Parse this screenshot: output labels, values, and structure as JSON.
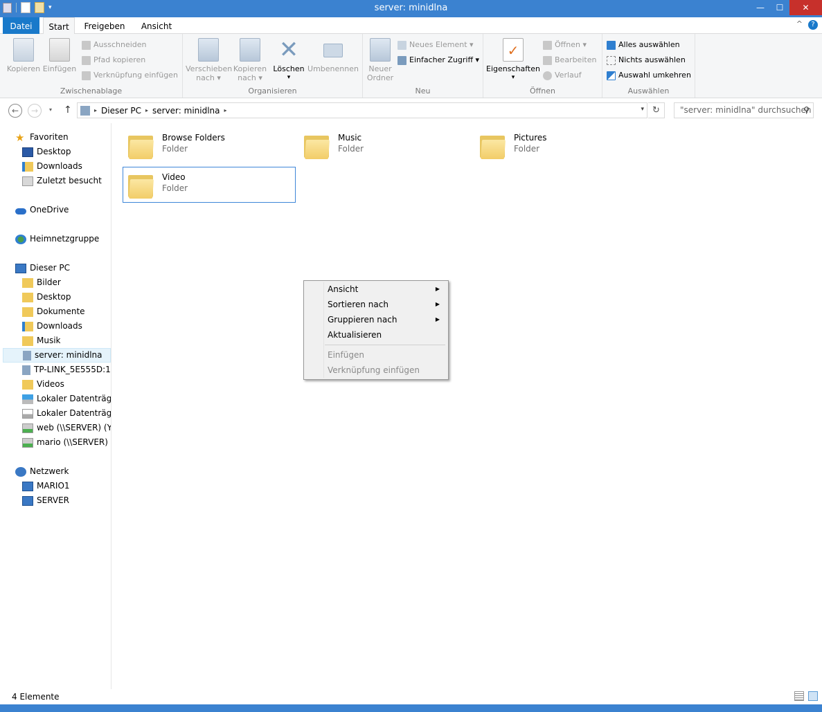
{
  "window": {
    "title": "server: minidlna",
    "controls": {
      "minimize": "—",
      "maximize": "☐",
      "close": "✕"
    }
  },
  "tabs": {
    "file": "Datei",
    "start": "Start",
    "share": "Freigeben",
    "view": "Ansicht",
    "help": "?",
    "collapse": "^"
  },
  "ribbon": {
    "clipboard": {
      "label": "Zwischenablage",
      "copy": "Kopieren",
      "paste": "Einfügen",
      "cut": "Ausschneiden",
      "copy_path": "Pfad kopieren",
      "paste_link": "Verknüpfung einfügen"
    },
    "organize": {
      "label": "Organisieren",
      "move_to": [
        "Verschieben",
        "nach ▾"
      ],
      "copy_to": [
        "Kopieren",
        "nach ▾"
      ],
      "delete": "Löschen",
      "delete_arrow": "▾",
      "rename": "Umbenennen"
    },
    "new": {
      "label": "Neu",
      "new_folder": [
        "Neuer",
        "Ordner"
      ],
      "new_item": "Neues Element ▾",
      "easy_access": "Einfacher Zugriff ▾"
    },
    "open": {
      "label": "Öffnen",
      "properties": "Eigenschaften",
      "properties_arrow": "▾",
      "open": "Öffnen ▾",
      "edit": "Bearbeiten",
      "history": "Verlauf"
    },
    "select": {
      "label": "Auswählen",
      "select_all": "Alles auswählen",
      "select_none": "Nichts auswählen",
      "invert": "Auswahl umkehren"
    }
  },
  "address": {
    "back": "←",
    "forward": "→",
    "recent": "▾",
    "up": "↑",
    "crumbs": [
      "Dieser PC",
      "server: minidlna"
    ],
    "separator": "▸",
    "dropdown": "▾",
    "refresh": "↻",
    "search_placeholder": "\"server: minidlna\" durchsuchen",
    "search_icon": "⚲"
  },
  "nav": {
    "favorites": "Favoriten",
    "fav_items": [
      "Desktop",
      "Downloads",
      "Zuletzt besucht"
    ],
    "onedrive": "OneDrive",
    "homegroup": "Heimnetzgruppe",
    "thispc": "Dieser PC",
    "pc_items": [
      "Bilder",
      "Desktop",
      "Dokumente",
      "Downloads",
      "Musik",
      "server: minidlna",
      "TP-LINK_5E555D:1",
      "Videos",
      "Lokaler Datenträger",
      "Lokaler Datenträger",
      "web (\\\\SERVER) (Y:)",
      "mario (\\\\SERVER) (Z"
    ],
    "network": "Netzwerk",
    "net_items": [
      "MARIO1",
      "SERVER"
    ]
  },
  "content": {
    "items": [
      {
        "name": "Browse Folders",
        "type": "Folder"
      },
      {
        "name": "Music",
        "type": "Folder"
      },
      {
        "name": "Pictures",
        "type": "Folder"
      },
      {
        "name": "Video",
        "type": "Folder"
      }
    ]
  },
  "context_menu": {
    "items": [
      {
        "label": "Ansicht",
        "submenu": "▶"
      },
      {
        "label": "Sortieren nach",
        "submenu": "▶"
      },
      {
        "label": "Gruppieren nach",
        "submenu": "▶"
      },
      {
        "label": "Aktualisieren"
      },
      {
        "label": "Einfügen"
      },
      {
        "label": "Verknüpfung einfügen"
      }
    ]
  },
  "status": {
    "count": "4 Elemente"
  },
  "colors": {
    "accent": "#1979ca",
    "titlebar": "#3b82d0",
    "close": "#c7302b",
    "folder": "#f2cd68"
  }
}
